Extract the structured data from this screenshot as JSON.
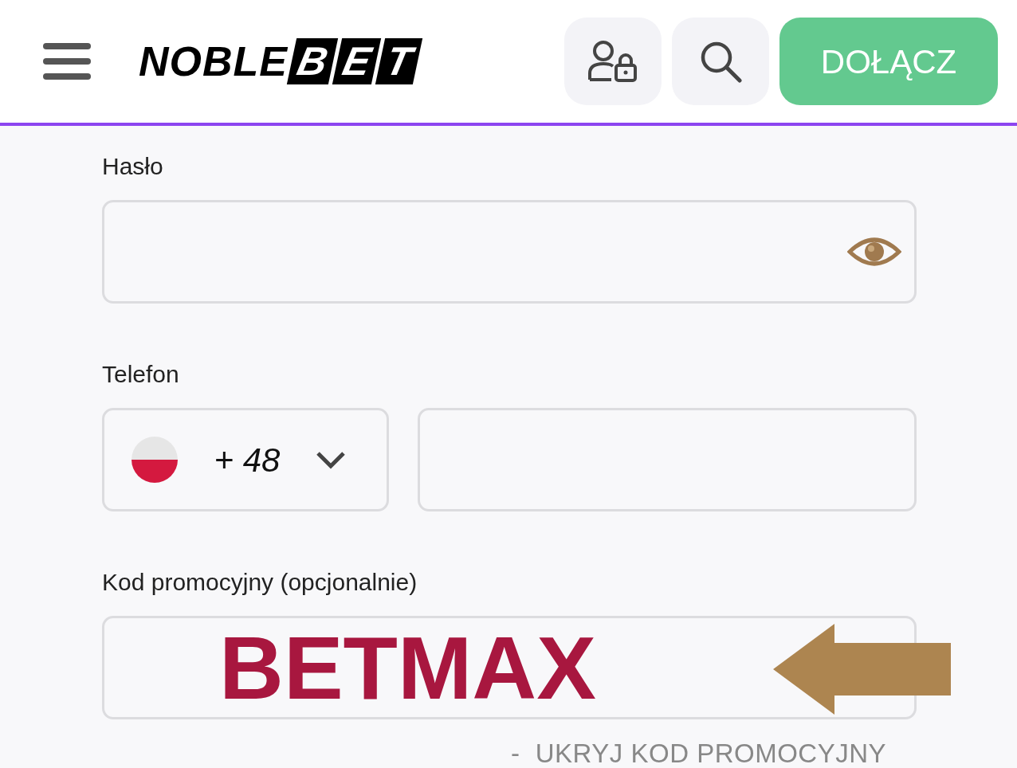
{
  "header": {
    "logo": {
      "word": "NOBLE",
      "boxed_letters": [
        "B",
        "E",
        "T"
      ]
    },
    "join_button": "DOŁĄCZ"
  },
  "form": {
    "password": {
      "label": "Hasło"
    },
    "phone": {
      "label": "Telefon",
      "country_code": "+ 48"
    },
    "promo": {
      "label": "Kod promocyjny (opcjonalnie)",
      "value": "BETMAX"
    },
    "hide_promo_link": "-  UKRYJ KOD PROMOCYJNY"
  }
}
